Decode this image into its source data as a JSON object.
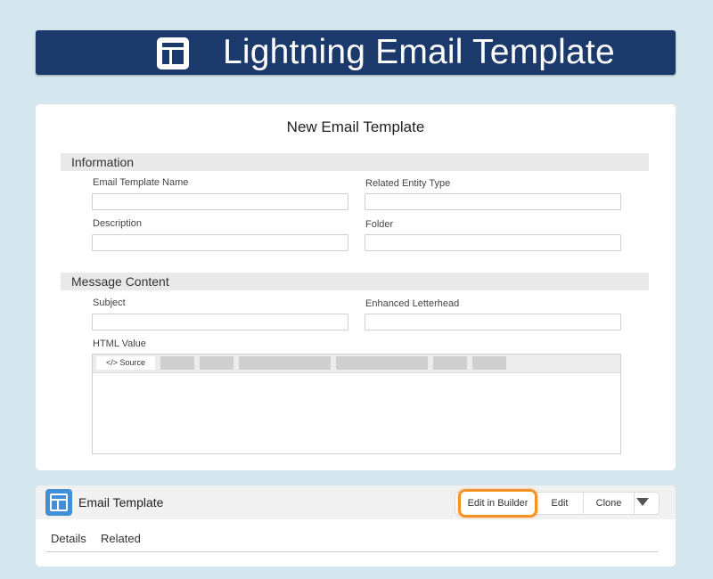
{
  "banner": {
    "title": "Lightning Email Template",
    "icon": "template-layout-icon",
    "background": "#1b3a6b"
  },
  "form": {
    "title": "New Email Template",
    "sections": {
      "information": {
        "header": "Information",
        "fields": {
          "email_template_name": {
            "label": "Email Template Name",
            "value": ""
          },
          "related_entity_type": {
            "label": "Related Entity Type",
            "value": ""
          },
          "description": {
            "label": "Description",
            "value": ""
          },
          "folder": {
            "label": "Folder",
            "value": ""
          }
        }
      },
      "message_content": {
        "header": "Message Content",
        "fields": {
          "subject": {
            "label": "Subject",
            "value": ""
          },
          "enhanced_letterhead": {
            "label": "Enhanced Letterhead",
            "value": ""
          },
          "html_value": {
            "label": "HTML Value",
            "value": ""
          }
        },
        "editor": {
          "source_button": "</> Source"
        }
      }
    }
  },
  "record": {
    "icon": "template-layout-icon",
    "title": "Email Template",
    "actions": {
      "edit_in_builder": "Edit in Builder",
      "edit": "Edit",
      "clone": "Clone",
      "more": "chevron-down-icon"
    },
    "highlight_color": "#f59122",
    "tabs": {
      "details": "Details",
      "related": "Related"
    }
  }
}
